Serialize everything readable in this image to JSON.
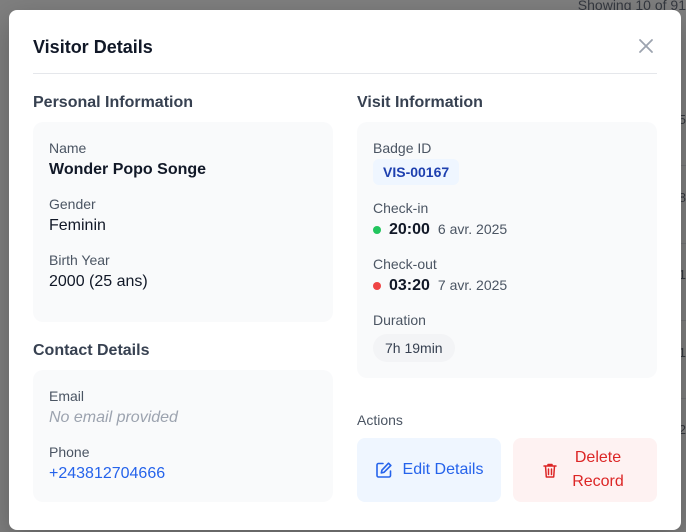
{
  "background": {
    "showing_text": "Showing 10 of 91",
    "edge_chars": [
      "5",
      "8",
      "1",
      "1",
      "2"
    ]
  },
  "modal": {
    "title": "Visitor Details",
    "close_icon": "close-icon"
  },
  "personal": {
    "title": "Personal Information",
    "name_label": "Name",
    "name_value": "Wonder Popo Songe",
    "gender_label": "Gender",
    "gender_value": "Feminin",
    "birth_label": "Birth Year",
    "birth_value": "2000 (25 ans)"
  },
  "contact": {
    "title": "Contact Details",
    "email_label": "Email",
    "email_value": "No email provided",
    "phone_label": "Phone",
    "phone_value": "+243812704666"
  },
  "visit": {
    "title": "Visit Information",
    "badge_label": "Badge ID",
    "badge_value": "VIS-00167",
    "checkin_label": "Check-in",
    "checkin_time": "20:00",
    "checkin_date": "6 avr. 2025",
    "checkout_label": "Check-out",
    "checkout_time": "03:20",
    "checkout_date": "7 avr. 2025",
    "duration_label": "Duration",
    "duration_value": "7h 19min"
  },
  "actions": {
    "label": "Actions",
    "edit_label": "Edit Details",
    "edit_icon": "edit-icon",
    "delete_label": "Delete Record",
    "delete_icon": "trash-icon"
  },
  "colors": {
    "checkin_dot": "#22c55e",
    "checkout_dot": "#ef4444",
    "accent": "#2563eb",
    "danger": "#dc2626"
  }
}
